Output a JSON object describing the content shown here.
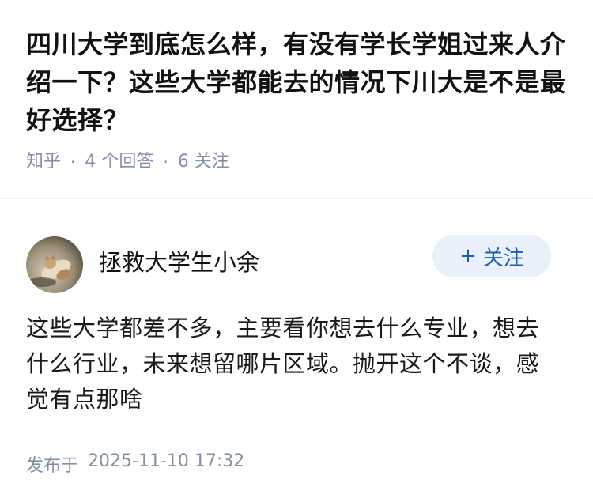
{
  "question": {
    "title": "四川大学到底怎么样，有没有学长学姐过来人介绍一下？这些大学都能去的情况下川大是不是最好选择？",
    "source": "知乎",
    "answer_count": "4 个回答",
    "follower_count": "6 关注"
  },
  "answer": {
    "author": {
      "name": "拯救大学生小余",
      "avatar_icon": "cat-photo-avatar"
    },
    "follow_button": {
      "plus": "+",
      "label": "关注"
    },
    "content": "这些大学都差不多，主要看你想去什么专业，想去什么行业，未来想留哪片区域。抛开这个不谈，感觉有点那啥",
    "published_label": "发布于",
    "published_time": "2025-11-10 17:32"
  },
  "colors": {
    "meta_gray": "#8590a6",
    "follow_bg": "#eaf1fa",
    "follow_text": "#1a5fb4",
    "divider": "#f0f0f0"
  }
}
